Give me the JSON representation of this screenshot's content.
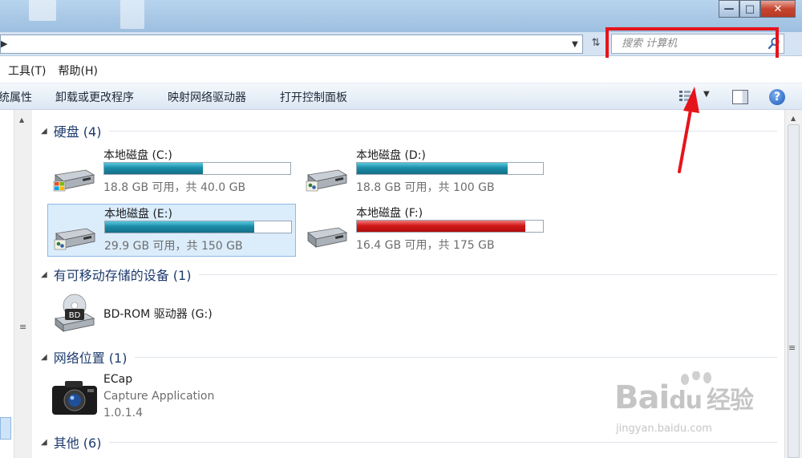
{
  "window": {
    "minimize": "—",
    "maximize": "□",
    "close": "✕"
  },
  "address": {
    "search_placeholder": "搜索 计算机"
  },
  "menu": [
    "工具(T)",
    "帮助(H)"
  ],
  "toolbar": {
    "properties": "统属性",
    "uninstall": "卸载或更改程序",
    "map_drive": "映射网络驱动器",
    "control_panel": "打开控制面板"
  },
  "groups": {
    "hard_disks": "硬盘 (4)",
    "removable": "有可移动存储的设备 (1)",
    "network": "网络位置 (1)",
    "other": "其他 (6)"
  },
  "drives": [
    {
      "name": "本地磁盘 (C:)",
      "capacity": "18.8 GB 可用，共 40.0 GB",
      "used_fraction": 0.53,
      "color": "#1b8da8",
      "selected": false
    },
    {
      "name": "本地磁盘 (D:)",
      "capacity": "18.8 GB 可用，共 100 GB",
      "used_fraction": 0.812,
      "color": "#1b8da8",
      "selected": false
    },
    {
      "name": "本地磁盘 (E:)",
      "capacity": "29.9 GB 可用，共 150 GB",
      "used_fraction": 0.8,
      "color": "#1b8da8",
      "selected": true
    },
    {
      "name": "本地磁盘 (F:)",
      "capacity": "16.4 GB 可用，共 175 GB",
      "used_fraction": 0.906,
      "color": "#d21818",
      "selected": false
    }
  ],
  "bdrom": {
    "name": "BD-ROM 驱动器 (G:)",
    "badge": "BD"
  },
  "network_item": {
    "name": "ECap",
    "desc": "Capture Application",
    "version": "1.0.1.4"
  },
  "watermark": {
    "brand": "Bai",
    "brand2": "du",
    "cn": "经验",
    "url": "jingyan.baidu.com"
  },
  "colors": {
    "highlight": "#e5141b",
    "accent_blue": "#1e3b6e"
  }
}
